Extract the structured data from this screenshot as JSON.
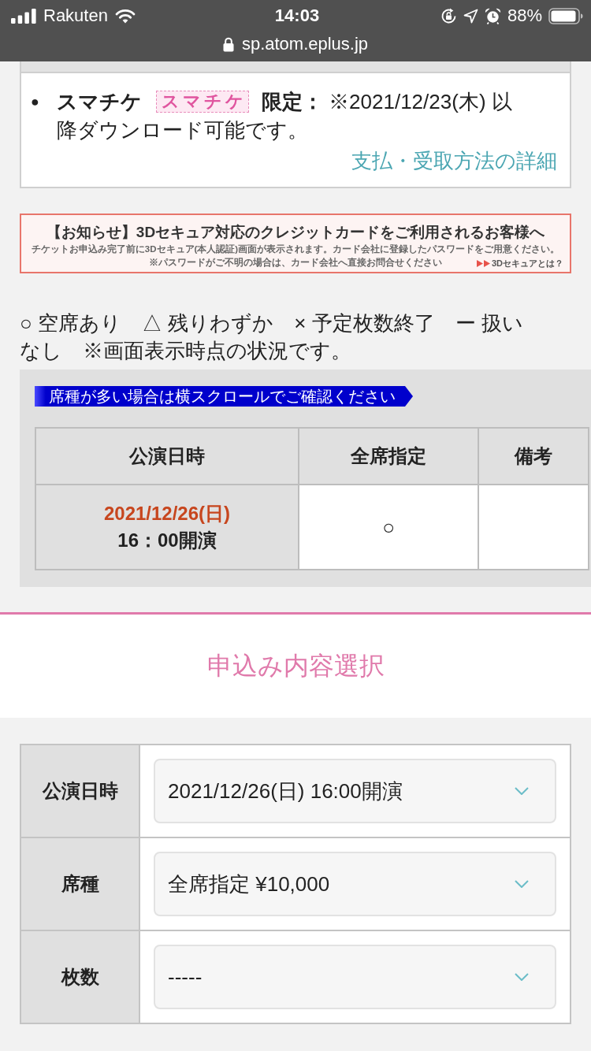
{
  "status_bar": {
    "carrier": "Rakuten",
    "time": "14:03",
    "battery": "88%",
    "url": "sp.atom.eplus.jp"
  },
  "smachike_note": {
    "bullet": "●",
    "label": "スマチケ",
    "badge": "スマチケ",
    "label_suffix": "限定：",
    "text": "※2021/12/23(木) 以降ダウンロード可能です。",
    "link": "支払・受取方法の詳細"
  },
  "notice_banner": {
    "title": "【お知らせ】3Dセキュア対応のクレジットカードをご利用されるお客様へ",
    "lines": [
      "チケットお申込み完了前に3Dセキュア(本人認証)画面が表示されます。カード会社に登録したパスワードをご用意ください。",
      "※パスワードがご不明の場合は、カード会社へ直接お問合せください"
    ],
    "link": "3Dセキュアとは？"
  },
  "legend": "○ 空席あり　△ 残りわずか　× 予定枚数終了　ー 扱いなし　※画面表示時点の状況です。",
  "availability": {
    "hint": "席種が多い場合は横スクロールでご確認ください",
    "columns": [
      "公演日時",
      "全席指定",
      "備考"
    ],
    "rows": [
      {
        "date": "2021/12/26(日)",
        "time": "16：00開演",
        "seat_status": "○"
      }
    ]
  },
  "section_title": "申込み内容選択",
  "application_form": {
    "fields": [
      {
        "label": "公演日時",
        "value": "2021/12/26(日) 16:00開演"
      },
      {
        "label": "席種",
        "value": "全席指定 ¥10,000"
      },
      {
        "label": "枚数",
        "value": "-----"
      }
    ]
  }
}
